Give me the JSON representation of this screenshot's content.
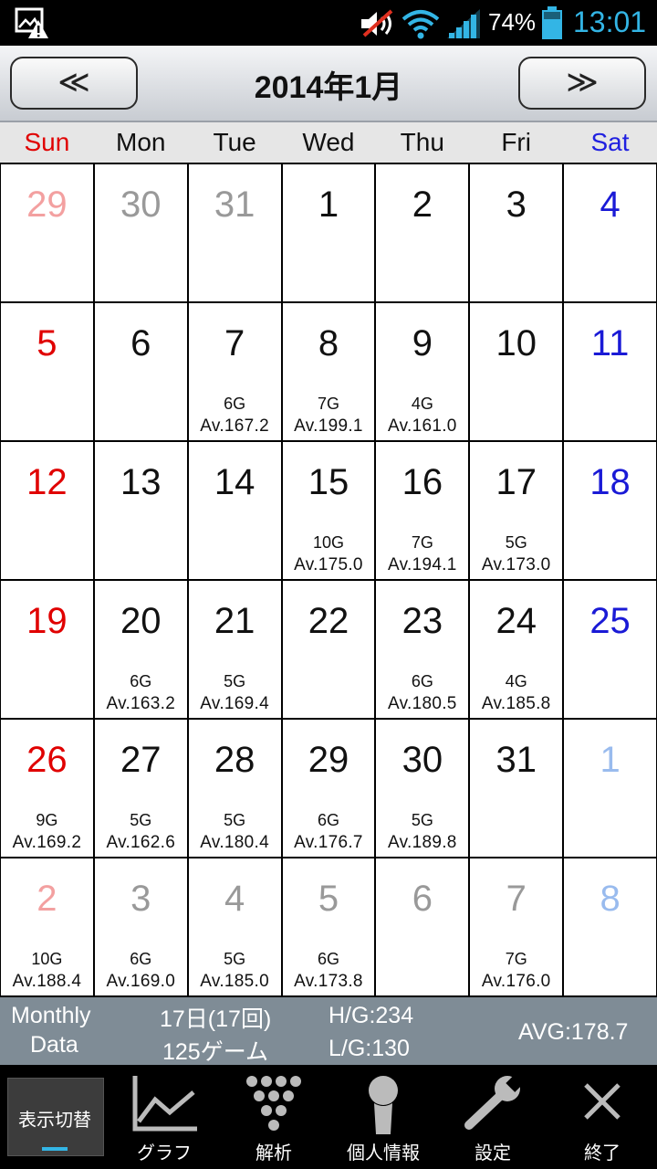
{
  "status_bar": {
    "battery": "74%",
    "time": "13:01"
  },
  "header": {
    "prev_label": "≪",
    "next_label": "≫",
    "title": "2014年1月"
  },
  "weekdays": [
    "Sun",
    "Mon",
    "Tue",
    "Wed",
    "Thu",
    "Fri",
    "Sat"
  ],
  "weeks": [
    [
      {
        "day": "29",
        "other": true
      },
      {
        "day": "30",
        "other": true
      },
      {
        "day": "31",
        "other": true
      },
      {
        "day": "1"
      },
      {
        "day": "2"
      },
      {
        "day": "3"
      },
      {
        "day": "4"
      }
    ],
    [
      {
        "day": "5"
      },
      {
        "day": "6"
      },
      {
        "day": "7",
        "games": "6G",
        "avg": "Av.167.2"
      },
      {
        "day": "8",
        "games": "7G",
        "avg": "Av.199.1"
      },
      {
        "day": "9",
        "games": "4G",
        "avg": "Av.161.0"
      },
      {
        "day": "10"
      },
      {
        "day": "11"
      }
    ],
    [
      {
        "day": "12"
      },
      {
        "day": "13"
      },
      {
        "day": "14"
      },
      {
        "day": "15",
        "games": "10G",
        "avg": "Av.175.0"
      },
      {
        "day": "16",
        "games": "7G",
        "avg": "Av.194.1"
      },
      {
        "day": "17",
        "games": "5G",
        "avg": "Av.173.0"
      },
      {
        "day": "18"
      }
    ],
    [
      {
        "day": "19"
      },
      {
        "day": "20",
        "games": "6G",
        "avg": "Av.163.2"
      },
      {
        "day": "21",
        "games": "5G",
        "avg": "Av.169.4"
      },
      {
        "day": "22"
      },
      {
        "day": "23",
        "games": "6G",
        "avg": "Av.180.5"
      },
      {
        "day": "24",
        "games": "4G",
        "avg": "Av.185.8"
      },
      {
        "day": "25"
      }
    ],
    [
      {
        "day": "26",
        "games": "9G",
        "avg": "Av.169.2"
      },
      {
        "day": "27",
        "games": "5G",
        "avg": "Av.162.6"
      },
      {
        "day": "28",
        "games": "5G",
        "avg": "Av.180.4"
      },
      {
        "day": "29",
        "games": "6G",
        "avg": "Av.176.7"
      },
      {
        "day": "30",
        "games": "5G",
        "avg": "Av.189.8"
      },
      {
        "day": "31"
      },
      {
        "day": "1",
        "other": true
      }
    ],
    [
      {
        "day": "2",
        "other": true,
        "games": "10G",
        "avg": "Av.188.4"
      },
      {
        "day": "3",
        "other": true,
        "games": "6G",
        "avg": "Av.169.0"
      },
      {
        "day": "4",
        "other": true,
        "games": "5G",
        "avg": "Av.185.0"
      },
      {
        "day": "5",
        "other": true,
        "games": "6G",
        "avg": "Av.173.8"
      },
      {
        "day": "6",
        "other": true
      },
      {
        "day": "7",
        "other": true,
        "games": "7G",
        "avg": "Av.176.0"
      },
      {
        "day": "8",
        "other": true
      }
    ]
  ],
  "summary": {
    "label_line1": "Monthly",
    "label_line2": "Data",
    "days": "17日(17回)",
    "games": "125ゲーム",
    "high": "H/G:234",
    "low": "L/G:130",
    "avg": "AVG:178.7"
  },
  "bottom_bar": {
    "toggle": "表示切替",
    "graph": "グラフ",
    "analysis": "解析",
    "personal": "個人情報",
    "settings": "設定",
    "exit": "終了"
  },
  "colors": {
    "sunday": "#e00000",
    "saturday": "#1a1ad6",
    "accent": "#33b5e5",
    "summary_bg": "#7f8c96"
  }
}
